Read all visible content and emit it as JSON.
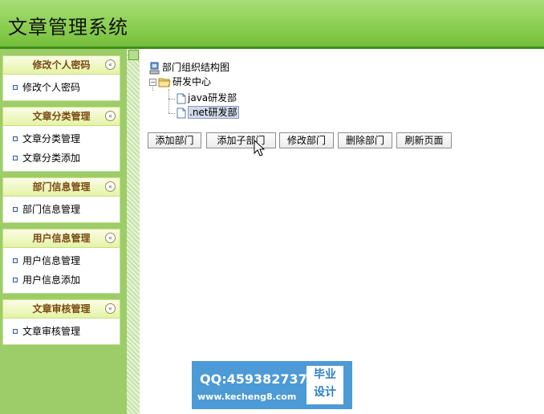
{
  "header": {
    "title": "文章管理系统"
  },
  "sidebar": {
    "collapse_glyph": "«",
    "groups": [
      {
        "title": "修改个人密码",
        "items": [
          "修改个人密码"
        ]
      },
      {
        "title": "文章分类管理",
        "items": [
          "文章分类管理",
          "文章分类添加"
        ]
      },
      {
        "title": "部门信息管理",
        "items": [
          "部门信息管理"
        ]
      },
      {
        "title": "用户信息管理",
        "items": [
          "用户信息管理",
          "用户信息添加"
        ]
      },
      {
        "title": "文章审核管理",
        "items": [
          "文章审核管理"
        ]
      }
    ]
  },
  "tree": {
    "root": "部门组织结构图",
    "center": "研发中心",
    "center_toggle": "−",
    "children": [
      "java研发部",
      ".net研发部"
    ],
    "selected": ".net研发部"
  },
  "toolbar": {
    "buttons": [
      "添加部门",
      "添加子部门",
      "修改部门",
      "删除部门",
      "刷新页面"
    ]
  },
  "watermark": {
    "qq": "QQ:459382737",
    "url": "www.kecheng8.com",
    "badge_line1": "毕业",
    "badge_line2": "设计"
  },
  "colors": {
    "header": "#8ccf52",
    "sidebar": "#9ccd68",
    "menu_title": "#7a4a12",
    "watermark": "#4c9ad6"
  }
}
